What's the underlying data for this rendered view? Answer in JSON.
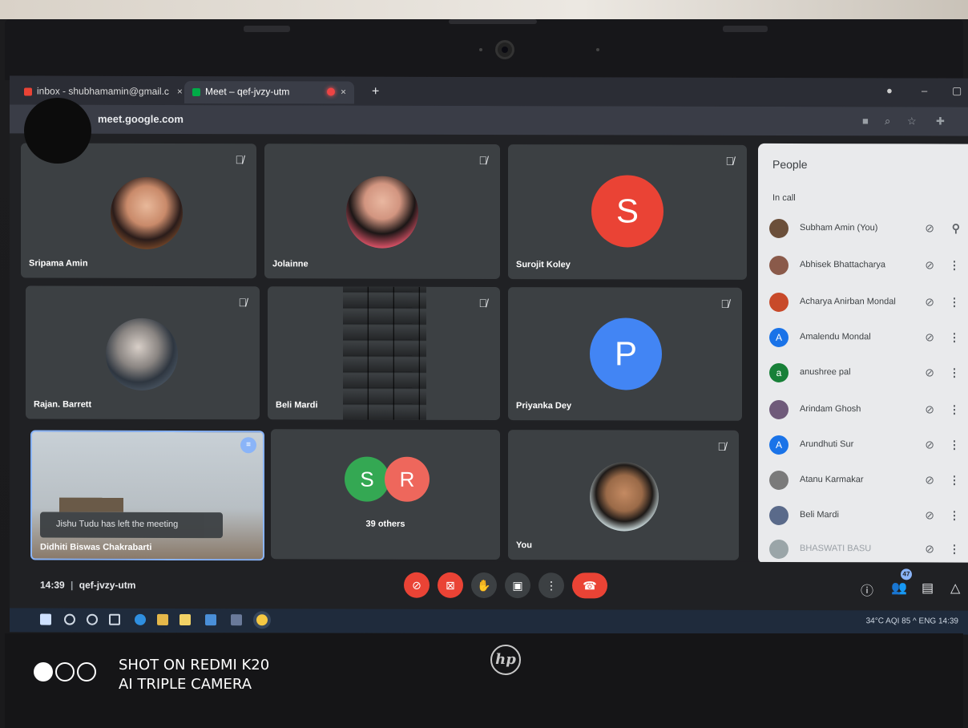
{
  "browser": {
    "tabs": [
      {
        "label": "inbox - shubhamamin@gmail.c",
        "close": "×"
      },
      {
        "label": "Meet – qef-jvzy-utm",
        "close": "×"
      }
    ],
    "new_tab": "+",
    "url": "meet.google.com"
  },
  "tiles": [
    {
      "name": "Sripama Amin",
      "muted": true
    },
    {
      "name": "Jolainne",
      "muted": true
    },
    {
      "name": "Surojit Koley",
      "muted": true,
      "letter": "S",
      "color": "#ea4335"
    },
    {
      "name": "Rajan. Barrett",
      "muted": true
    },
    {
      "name": "Beli Mardi",
      "muted": true
    },
    {
      "name": "Priyanka Dey",
      "muted": true,
      "letter": "P",
      "color": "#4285f4"
    },
    {
      "name": "Didhiti Biswas Chakrabarti",
      "speaking": true
    },
    {
      "name": "39 others",
      "letters": [
        "S",
        "R"
      ],
      "colors": [
        "#34a853",
        "#ea4335"
      ]
    },
    {
      "name": "You",
      "muted": true
    }
  ],
  "toast": "Jishu Tudu has left the meeting",
  "people_panel": {
    "title": "People",
    "section": "In call",
    "participants": [
      {
        "name": "Subham Amin (You)",
        "avatar_color": "#6b4f3a"
      },
      {
        "name": "Abhisek Bhattacharya",
        "avatar_color": "#8a5a4a"
      },
      {
        "name": "Acharya Anirban Mondal",
        "avatar_color": "#c84a2a"
      },
      {
        "name": "Amalendu Mondal",
        "letter": "A",
        "avatar_color": "#1a73e8"
      },
      {
        "name": "anushree pal",
        "letter": "a",
        "avatar_color": "#188038"
      },
      {
        "name": "Arindam Ghosh",
        "avatar_color": "#6f5a7a"
      },
      {
        "name": "Arundhuti Sur",
        "letter": "A",
        "avatar_color": "#1a73e8"
      },
      {
        "name": "Atanu Karmakar",
        "avatar_color": "#7a7a7a"
      },
      {
        "name": "Beli Mardi",
        "avatar_color": "#5a6a8a"
      },
      {
        "name": "BHASWATI BASU",
        "avatar_color": "#9aa5a8"
      }
    ]
  },
  "bottom_bar": {
    "time": "14:39",
    "separator": "|",
    "meeting_code": "qef-jvzy-utm",
    "people_count": "47"
  },
  "taskbar": {
    "tray": "34°C AQI 85  ^  ENG  14:39"
  },
  "watermark": {
    "line1": "SHOT ON REDMI K20",
    "line2": "AI TRIPLE CAMERA"
  },
  "laptop_logo": "hp"
}
